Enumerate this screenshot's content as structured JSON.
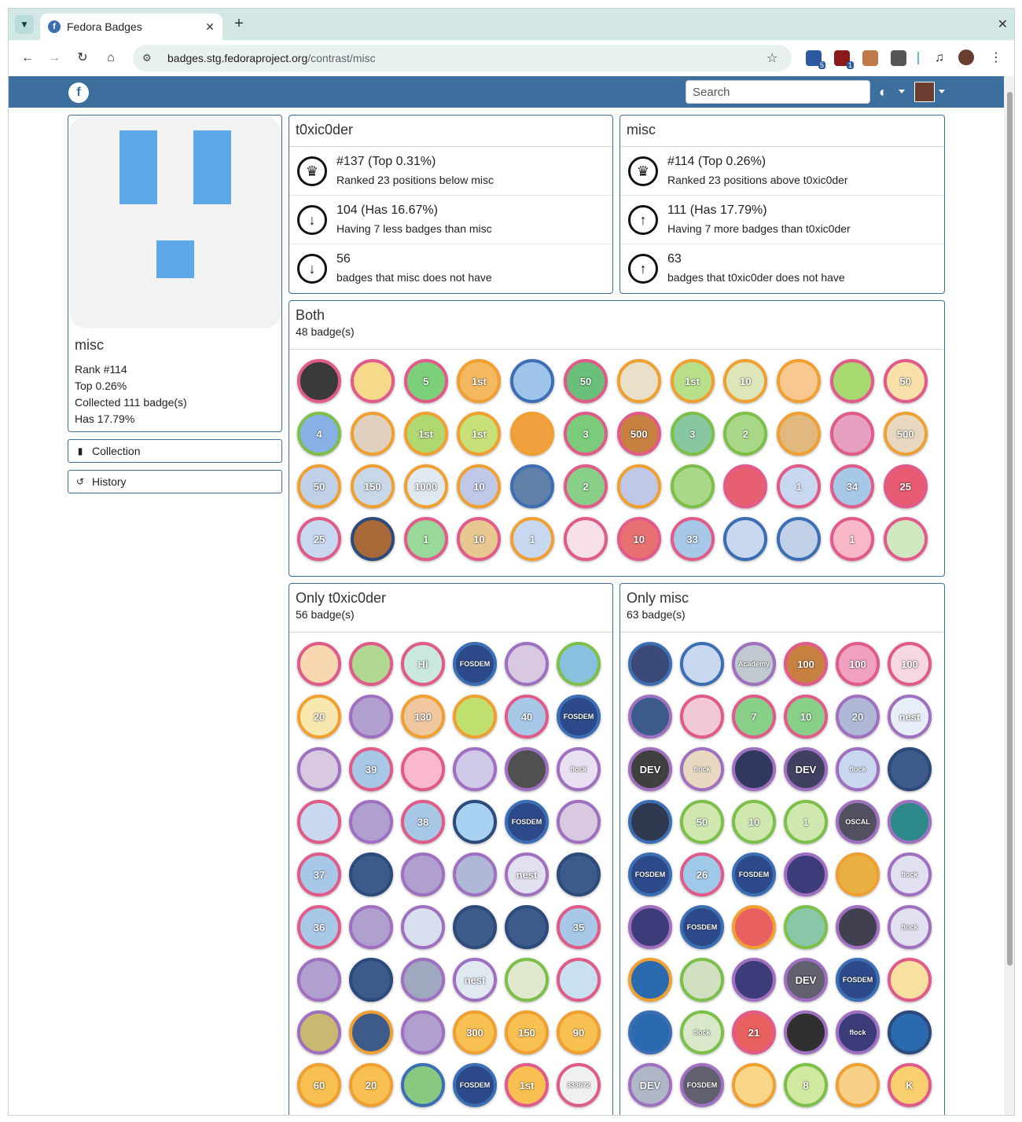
{
  "browser": {
    "tab_title": "Fedora Badges",
    "url_host": "badges.stg.fedoraproject.org",
    "url_path": "/contrast/misc",
    "extensions": [
      {
        "name": "calendar-extension-icon",
        "badge": "5",
        "color": "#2c5aa0"
      },
      {
        "name": "shield-extension-icon",
        "badge": "1",
        "color": "#8b1a1a"
      },
      {
        "name": "mask-extension-icon",
        "badge": "",
        "color": "#c07a4a"
      },
      {
        "name": "puzzle-extension-icon",
        "badge": "",
        "color": "#555555"
      }
    ]
  },
  "sitenav": {
    "search_placeholder": "Search"
  },
  "profile": {
    "name": "misc",
    "rank": "Rank #114",
    "top": "Top 0.26%",
    "collected": "Collected 111 badge(s)",
    "has": "Has 17.79%"
  },
  "side_buttons": {
    "collection": "Collection",
    "history": "History"
  },
  "left_user": {
    "name": "t0xic0der",
    "rank_big": "#137 (Top 0.31%)",
    "rank_small": "Ranked 23 positions below misc",
    "count_big": "104 (Has 16.67%)",
    "count_small": "Having 7 less badges than misc",
    "unique_big": "56",
    "unique_small": "badges that misc does not have"
  },
  "right_user": {
    "name": "misc",
    "rank_big": "#114 (Top 0.26%)",
    "rank_small": "Ranked 23 positions above t0xic0der",
    "count_big": "111 (Has 17.79%)",
    "count_small": "Having 7 more badges than t0xic0der",
    "unique_big": "63",
    "unique_small": "badges that t0xic0der does not have"
  },
  "both": {
    "title": "Both",
    "count": "48 badge(s)",
    "badges": [
      {
        "fill": "#3a3a3a",
        "ring": "#e05a8a",
        "label": ""
      },
      {
        "fill": "#f6d98a",
        "ring": "#e05a8a",
        "label": ""
      },
      {
        "fill": "#7dd07a",
        "ring": "#e05a8a",
        "label": "5"
      },
      {
        "fill": "#f4b860",
        "ring": "#f0a030",
        "label": "1st"
      },
      {
        "fill": "#9ec4ea",
        "ring": "#3c6eb4",
        "label": ""
      },
      {
        "fill": "#6ac07a",
        "ring": "#e05a8a",
        "label": "50"
      },
      {
        "fill": "#e8e0c8",
        "ring": "#f0a030",
        "label": ""
      },
      {
        "fill": "#b8e08a",
        "ring": "#f0a030",
        "label": "1st"
      },
      {
        "fill": "#dce6b8",
        "ring": "#f0a030",
        "label": "10"
      },
      {
        "fill": "#f8c890",
        "ring": "#f0a030",
        "label": ""
      },
      {
        "fill": "#a8d870",
        "ring": "#e05a8a",
        "label": ""
      },
      {
        "fill": "#f8e0a8",
        "ring": "#e05a8a",
        "label": "50"
      },
      {
        "fill": "#8ab0e8",
        "ring": "#7cc04a",
        "label": "4"
      },
      {
        "fill": "#e0d0c0",
        "ring": "#f0a030",
        "label": ""
      },
      {
        "fill": "#b0d870",
        "ring": "#f0a030",
        "label": "1st"
      },
      {
        "fill": "#c8e078",
        "ring": "#f0a030",
        "label": "1st"
      },
      {
        "fill": "#f0a040",
        "ring": "#f0a030",
        "label": ""
      },
      {
        "fill": "#7acc7a",
        "ring": "#e05a8a",
        "label": "3"
      },
      {
        "fill": "#c88040",
        "ring": "#e05a8a",
        "label": "500"
      },
      {
        "fill": "#88c8a0",
        "ring": "#7cc04a",
        "label": "3"
      },
      {
        "fill": "#a8d888",
        "ring": "#7cc04a",
        "label": "2"
      },
      {
        "fill": "#e0b880",
        "ring": "#f0a030",
        "label": ""
      },
      {
        "fill": "#e8a0c0",
        "ring": "#e05a8a",
        "label": ""
      },
      {
        "fill": "#e8d8c0",
        "ring": "#f0a030",
        "label": "500"
      },
      {
        "fill": "#c0d0e8",
        "ring": "#f0a030",
        "label": "50"
      },
      {
        "fill": "#c8d8e8",
        "ring": "#f0a030",
        "label": "150"
      },
      {
        "fill": "#e0e8f0",
        "ring": "#f0a030",
        "label": "1000"
      },
      {
        "fill": "#c0c8e8",
        "ring": "#f0a030",
        "label": "10"
      },
      {
        "fill": "#6080a8",
        "ring": "#3c6eb4",
        "label": ""
      },
      {
        "fill": "#88d088",
        "ring": "#e05a8a",
        "label": "2"
      },
      {
        "fill": "#c0c8e8",
        "ring": "#f0a030",
        "label": ""
      },
      {
        "fill": "#a8d888",
        "ring": "#7cc04a",
        "label": ""
      },
      {
        "fill": "#e86070",
        "ring": "#e05a8a",
        "label": ""
      },
      {
        "fill": "#c8d8f0",
        "ring": "#e05a8a",
        "label": "1"
      },
      {
        "fill": "#a8c8e8",
        "ring": "#e05a8a",
        "label": "34"
      },
      {
        "fill": "#e85a70",
        "ring": "#e05a8a",
        "label": "25"
      },
      {
        "fill": "#c8d8f0",
        "ring": "#e05a8a",
        "label": "25"
      },
      {
        "fill": "#a86838",
        "ring": "#2c4a7a",
        "label": ""
      },
      {
        "fill": "#98d898",
        "ring": "#e05a8a",
        "label": "1"
      },
      {
        "fill": "#e8c890",
        "ring": "#e05a8a",
        "label": "10"
      },
      {
        "fill": "#c8d8f0",
        "ring": "#f0a030",
        "label": "1"
      },
      {
        "fill": "#f8e0e8",
        "ring": "#e05a8a",
        "label": ""
      },
      {
        "fill": "#e87070",
        "ring": "#e05a8a",
        "label": "10"
      },
      {
        "fill": "#a8c8e8",
        "ring": "#e05a8a",
        "label": "33"
      },
      {
        "fill": "#c8d8f0",
        "ring": "#3c6eb4",
        "label": ""
      },
      {
        "fill": "#c0d0e8",
        "ring": "#3c6eb4",
        "label": ""
      },
      {
        "fill": "#f8b8c8",
        "ring": "#e05a8a",
        "label": "1"
      },
      {
        "fill": "#d0e8c0",
        "ring": "#e05a8a",
        "label": ""
      }
    ]
  },
  "only_left": {
    "title": "Only t0xic0der",
    "count": "56 badge(s)",
    "badges": [
      {
        "fill": "#f8d8b0",
        "ring": "#e05a8a",
        "label": ""
      },
      {
        "fill": "#b0d890",
        "ring": "#e05a8a",
        "label": ""
      },
      {
        "fill": "#c8e8e0",
        "ring": "#e05a8a",
        "label": "Hi"
      },
      {
        "fill": "#2c4a8a",
        "ring": "#3c6eb4",
        "label": "FOSDEM"
      },
      {
        "fill": "#d8c8e0",
        "ring": "#a070c0",
        "label": ""
      },
      {
        "fill": "#88c0e0",
        "ring": "#7cc04a",
        "label": ""
      },
      {
        "fill": "#f8e8b0",
        "ring": "#f0a030",
        "label": "20"
      },
      {
        "fill": "#b0a0d0",
        "ring": "#a070c0",
        "label": ""
      },
      {
        "fill": "#f0c8a0",
        "ring": "#f0a030",
        "label": "130"
      },
      {
        "fill": "#c0e070",
        "ring": "#f0a030",
        "label": ""
      },
      {
        "fill": "#a8c8e8",
        "ring": "#e05a8a",
        "label": "40"
      },
      {
        "fill": "#2c4a8a",
        "ring": "#3c6eb4",
        "label": "FOSDEM"
      },
      {
        "fill": "#d8c8e0",
        "ring": "#a070c0",
        "label": ""
      },
      {
        "fill": "#a8c8e8",
        "ring": "#e05a8a",
        "label": "39"
      },
      {
        "fill": "#f8b8d0",
        "ring": "#e05a8a",
        "label": ""
      },
      {
        "fill": "#d0c8e8",
        "ring": "#a070c0",
        "label": ""
      },
      {
        "fill": "#505050",
        "ring": "#a070c0",
        "label": ""
      },
      {
        "fill": "#e8e0f0",
        "ring": "#a070c0",
        "label": "flock"
      },
      {
        "fill": "#c8d8f0",
        "ring": "#e05a8a",
        "label": ""
      },
      {
        "fill": "#b0a0d0",
        "ring": "#a070c0",
        "label": ""
      },
      {
        "fill": "#a8c8e8",
        "ring": "#e05a8a",
        "label": "38"
      },
      {
        "fill": "#a8d0f0",
        "ring": "#2c4a7a",
        "label": ""
      },
      {
        "fill": "#2c4a8a",
        "ring": "#3c6eb4",
        "label": "FOSDEM"
      },
      {
        "fill": "#d8c8e0",
        "ring": "#a070c0",
        "label": ""
      },
      {
        "fill": "#a8c8e8",
        "ring": "#e05a8a",
        "label": "37"
      },
      {
        "fill": "#3c5a8a",
        "ring": "#2c4a7a",
        "label": ""
      },
      {
        "fill": "#b0a0d0",
        "ring": "#a070c0",
        "label": ""
      },
      {
        "fill": "#b0b8d8",
        "ring": "#a070c0",
        "label": ""
      },
      {
        "fill": "#e0e0f0",
        "ring": "#a070c0",
        "label": "nest"
      },
      {
        "fill": "#3c5a8a",
        "ring": "#2c4a7a",
        "label": ""
      },
      {
        "fill": "#a8c8e8",
        "ring": "#e05a8a",
        "label": "36"
      },
      {
        "fill": "#b0a0d0",
        "ring": "#a070c0",
        "label": ""
      },
      {
        "fill": "#d8e0f0",
        "ring": "#a070c0",
        "label": ""
      },
      {
        "fill": "#3c5a8a",
        "ring": "#2c4a7a",
        "label": ""
      },
      {
        "fill": "#3c5a8a",
        "ring": "#2c4a7a",
        "label": ""
      },
      {
        "fill": "#a8c8e8",
        "ring": "#e05a8a",
        "label": "35"
      },
      {
        "fill": "#b0a0d0",
        "ring": "#a070c0",
        "label": ""
      },
      {
        "fill": "#3c5a8a",
        "ring": "#2c4a7a",
        "label": ""
      },
      {
        "fill": "#a0a8c0",
        "ring": "#a070c0",
        "label": ""
      },
      {
        "fill": "#e0e8f0",
        "ring": "#a070c0",
        "label": "nest"
      },
      {
        "fill": "#e0e8d0",
        "ring": "#7cc04a",
        "label": ""
      },
      {
        "fill": "#c8e0f0",
        "ring": "#e05a8a",
        "label": ""
      },
      {
        "fill": "#c8b870",
        "ring": "#a070c0",
        "label": ""
      },
      {
        "fill": "#3c5a8a",
        "ring": "#f0a030",
        "label": ""
      },
      {
        "fill": "#b0a0d0",
        "ring": "#a070c0",
        "label": ""
      },
      {
        "fill": "#f8c050",
        "ring": "#f0a030",
        "label": "300"
      },
      {
        "fill": "#f8c050",
        "ring": "#f0a030",
        "label": "150"
      },
      {
        "fill": "#f8c050",
        "ring": "#f0a030",
        "label": "90"
      },
      {
        "fill": "#f8c050",
        "ring": "#f0a030",
        "label": "60"
      },
      {
        "fill": "#f8c050",
        "ring": "#f0a030",
        "label": "20"
      },
      {
        "fill": "#88c880",
        "ring": "#3c6eb4",
        "label": ""
      },
      {
        "fill": "#2c4a8a",
        "ring": "#3c6eb4",
        "label": "FOSDEM"
      },
      {
        "fill": "#f8c050",
        "ring": "#e05a8a",
        "label": "1st"
      },
      {
        "fill": "#f0f0f0",
        "ring": "#e05a8a",
        "label": "333672"
      }
    ]
  },
  "only_right": {
    "title": "Only misc",
    "count": "63 badge(s)",
    "badges": [
      {
        "fill": "#3c4a7a",
        "ring": "#3c6eb4",
        "label": ""
      },
      {
        "fill": "#c8d8f0",
        "ring": "#3c6eb4",
        "label": ""
      },
      {
        "fill": "#c0c8d0",
        "ring": "#a070c0",
        "label": "Academy"
      },
      {
        "fill": "#c88040",
        "ring": "#e05a8a",
        "label": "100"
      },
      {
        "fill": "#f0a0c0",
        "ring": "#e05a8a",
        "label": "100"
      },
      {
        "fill": "#f8d8e0",
        "ring": "#e05a8a",
        "label": "100"
      },
      {
        "fill": "#3c5a8a",
        "ring": "#a070c0",
        "label": ""
      },
      {
        "fill": "#f0c8d8",
        "ring": "#e05a8a",
        "label": ""
      },
      {
        "fill": "#88d088",
        "ring": "#e05a8a",
        "label": "7"
      },
      {
        "fill": "#88d088",
        "ring": "#e05a8a",
        "label": "10"
      },
      {
        "fill": "#b0b8d8",
        "ring": "#a070c0",
        "label": "20"
      },
      {
        "fill": "#e8eef8",
        "ring": "#a070c0",
        "label": "nest"
      },
      {
        "fill": "#404040",
        "ring": "#a070c0",
        "label": "DEV"
      },
      {
        "fill": "#e8d8c0",
        "ring": "#a070c0",
        "label": "flock"
      },
      {
        "fill": "#303860",
        "ring": "#a070c0",
        "label": ""
      },
      {
        "fill": "#404060",
        "ring": "#a070c0",
        "label": "DEV"
      },
      {
        "fill": "#c8d8f0",
        "ring": "#a070c0",
        "label": "flock"
      },
      {
        "fill": "#3c5a8a",
        "ring": "#2c4a7a",
        "label": ""
      },
      {
        "fill": "#303850",
        "ring": "#3c6eb4",
        "label": ""
      },
      {
        "fill": "#d0e8b0",
        "ring": "#7cc04a",
        "label": "50"
      },
      {
        "fill": "#d0e8b0",
        "ring": "#7cc04a",
        "label": "10"
      },
      {
        "fill": "#d0e8b0",
        "ring": "#7cc04a",
        "label": "1"
      },
      {
        "fill": "#505060",
        "ring": "#a070c0",
        "label": "OSCAL"
      },
      {
        "fill": "#2c8a8a",
        "ring": "#a070c0",
        "label": ""
      },
      {
        "fill": "#2c4a8a",
        "ring": "#3c6eb4",
        "label": "FOSDEM"
      },
      {
        "fill": "#a0c8e8",
        "ring": "#e05a8a",
        "label": "26"
      },
      {
        "fill": "#2c4a8a",
        "ring": "#3c6eb4",
        "label": "FOSDEM"
      },
      {
        "fill": "#3c3c7a",
        "ring": "#a070c0",
        "label": ""
      },
      {
        "fill": "#e8b040",
        "ring": "#f0a030",
        "label": ""
      },
      {
        "fill": "#e0e0f0",
        "ring": "#a070c0",
        "label": "flock"
      },
      {
        "fill": "#3c3c7a",
        "ring": "#a070c0",
        "label": ""
      },
      {
        "fill": "#2c4a8a",
        "ring": "#3c6eb4",
        "label": "FOSDEM"
      },
      {
        "fill": "#e86060",
        "ring": "#f0a030",
        "label": ""
      },
      {
        "fill": "#88c8a8",
        "ring": "#7cc04a",
        "label": ""
      },
      {
        "fill": "#404050",
        "ring": "#a070c0",
        "label": ""
      },
      {
        "fill": "#e0e0f0",
        "ring": "#a070c0",
        "label": "flock"
      },
      {
        "fill": "#2c6ab0",
        "ring": "#f0a030",
        "label": ""
      },
      {
        "fill": "#d0e0c0",
        "ring": "#7cc04a",
        "label": ""
      },
      {
        "fill": "#3c3c7a",
        "ring": "#a070c0",
        "label": ""
      },
      {
        "fill": "#606070",
        "ring": "#a070c0",
        "label": "DEV"
      },
      {
        "fill": "#2c4a8a",
        "ring": "#3c6eb4",
        "label": "FOSDEM"
      },
      {
        "fill": "#f8e0a0",
        "ring": "#e05a8a",
        "label": ""
      },
      {
        "fill": "#2c6ab0",
        "ring": "#3c6eb4",
        "label": ""
      },
      {
        "fill": "#d8e8c8",
        "ring": "#7cc04a",
        "label": "flock"
      },
      {
        "fill": "#e86060",
        "ring": "#e05a8a",
        "label": "21"
      },
      {
        "fill": "#303030",
        "ring": "#a070c0",
        "label": ""
      },
      {
        "fill": "#3c3c7a",
        "ring": "#a070c0",
        "label": "flock"
      },
      {
        "fill": "#2c6ab0",
        "ring": "#2c4a7a",
        "label": ""
      },
      {
        "fill": "#b0b8c8",
        "ring": "#a070c0",
        "label": "DEV"
      },
      {
        "fill": "#606070",
        "ring": "#a070c0",
        "label": "FOSDEM"
      },
      {
        "fill": "#f8d888",
        "ring": "#f0a030",
        "label": ""
      },
      {
        "fill": "#d0e8a0",
        "ring": "#7cc04a",
        "label": "8"
      },
      {
        "fill": "#f8d088",
        "ring": "#f0a030",
        "label": ""
      },
      {
        "fill": "#f8d070",
        "ring": "#e05a8a",
        "label": "K"
      }
    ]
  }
}
